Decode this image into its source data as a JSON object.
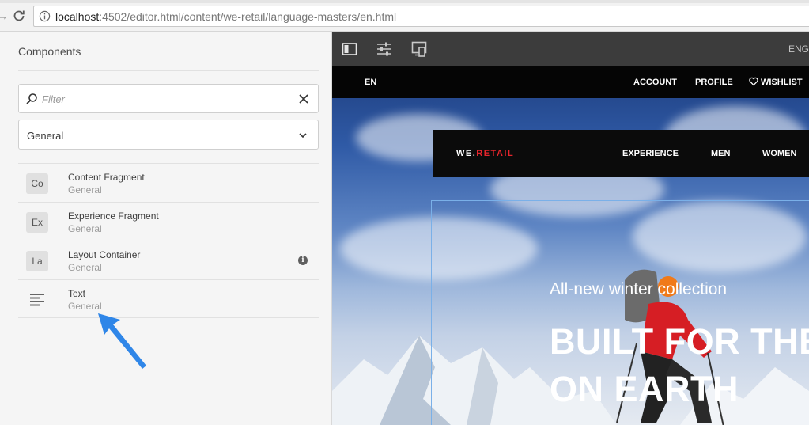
{
  "browser": {
    "url_host": "localhost",
    "url_path": ":4502/editor.html/content/we-retail/language-masters/en.html"
  },
  "panel": {
    "title": "Components",
    "filter_placeholder": "Filter",
    "group_select": "General",
    "items": [
      {
        "abbr": "Co",
        "title": "Content Fragment",
        "group": "General",
        "icon": "abbr-badge"
      },
      {
        "abbr": "Ex",
        "title": "Experience Fragment",
        "group": "General",
        "icon": "abbr-badge"
      },
      {
        "abbr": "La",
        "title": "Layout Container",
        "group": "General",
        "icon": "abbr-badge",
        "has_info": true
      },
      {
        "abbr": "",
        "title": "Text",
        "group": "General",
        "icon": "text-align-icon"
      }
    ]
  },
  "toolbar": {
    "icons": [
      "side-panel-icon",
      "properties-sliders-icon",
      "emulator-icon"
    ],
    "language": "ENG"
  },
  "site": {
    "topbar": {
      "lang": "EN",
      "account": "ACCOUNT",
      "profile": "PROFILE",
      "wishlist": "WISHLIST"
    },
    "logo_left": "WE.",
    "logo_right": "RETAIL",
    "nav": [
      "EXPERIENCE",
      "MEN",
      "WOMEN"
    ],
    "hero_kicker": "All-new winter collection",
    "hero_title_line1": "BUILT FOR THE",
    "hero_title_line2": "ON EARTH"
  },
  "colors": {
    "accent_blue": "#2f86e8",
    "brand_red": "#e5252c",
    "toolbar_bg": "#3c3c3c"
  }
}
